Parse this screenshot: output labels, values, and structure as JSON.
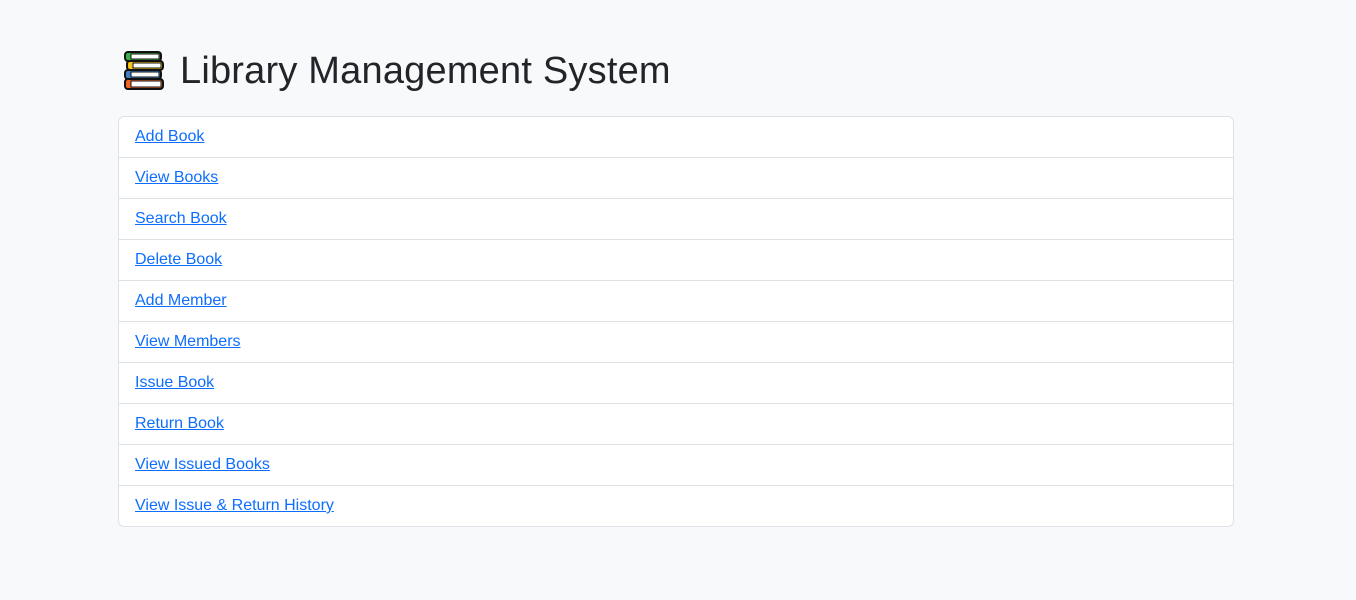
{
  "header": {
    "icon": "books-icon",
    "title": "Library Management System"
  },
  "menu": {
    "items": [
      {
        "label": "Add Book"
      },
      {
        "label": "View Books"
      },
      {
        "label": "Search Book"
      },
      {
        "label": "Delete Book"
      },
      {
        "label": "Add Member"
      },
      {
        "label": "View Members"
      },
      {
        "label": "Issue Book"
      },
      {
        "label": "Return Book"
      },
      {
        "label": "View Issued Books"
      },
      {
        "label": "View Issue & Return History"
      }
    ]
  },
  "colors": {
    "background": "#f8f9fa",
    "link": "#0d6efd",
    "border": "#dee2e6",
    "title": "#212529"
  }
}
